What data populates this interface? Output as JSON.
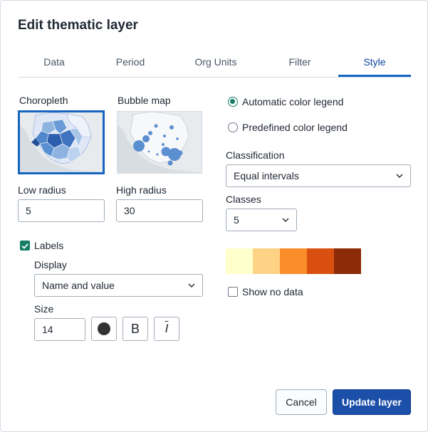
{
  "dialog": {
    "title": "Edit thematic layer"
  },
  "tabs": [
    {
      "label": "Data"
    },
    {
      "label": "Period"
    },
    {
      "label": "Org Units"
    },
    {
      "label": "Filter"
    },
    {
      "label": "Style"
    }
  ],
  "active_tab": "Style",
  "style_types": {
    "choropleth_label": "Choropleth",
    "bubble_label": "Bubble map",
    "selected": "Choropleth"
  },
  "radius": {
    "low_label": "Low radius",
    "low_value": "5",
    "high_label": "High radius",
    "high_value": "30"
  },
  "labels": {
    "checkbox_label": "Labels",
    "checked": true,
    "display_label": "Display",
    "display_value": "Name and value",
    "size_label": "Size",
    "size_value": "14",
    "font_color": "#333333",
    "bold_glyph": "B",
    "italic_glyph": "I"
  },
  "legend": {
    "automatic_label": "Automatic color legend",
    "predefined_label": "Predefined color legend",
    "selected": "Automatic color legend"
  },
  "classification": {
    "label": "Classification",
    "value": "Equal intervals"
  },
  "classes": {
    "label": "Classes",
    "value": "5"
  },
  "color_scale": [
    "#ffffcc",
    "#fed385",
    "#fc8d2b",
    "#d94f0f",
    "#8d2b09"
  ],
  "show_no_data": {
    "label": "Show no data",
    "checked": false
  },
  "footer": {
    "cancel_label": "Cancel",
    "update_label": "Update layer"
  },
  "colors": {
    "accent": "#1565c0",
    "primary_button": "#1b4fa8",
    "checkbox": "#147d64"
  }
}
